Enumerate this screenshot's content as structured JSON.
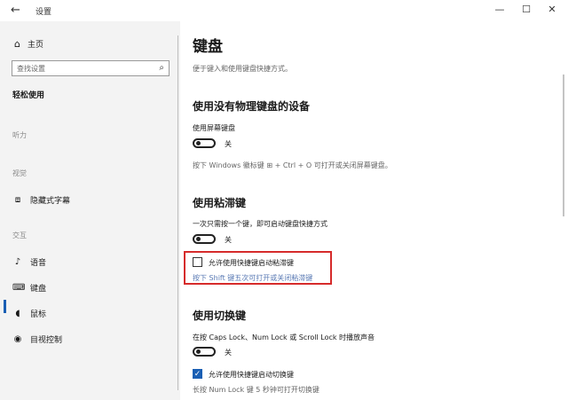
{
  "titlebar": {
    "back_glyph": "←",
    "title": "设置",
    "minimize": "—",
    "maximize": "☐",
    "close": "✕"
  },
  "sidebar": {
    "home_label": "主页",
    "search_placeholder": "查找设置",
    "category": "轻松使用",
    "groups": [
      "听力",
      "视觉",
      "交互"
    ],
    "items": [
      {
        "label": "隐藏式字幕",
        "icon": "caption-icon"
      },
      {
        "label": "语音",
        "icon": "microphone-icon"
      },
      {
        "label": "键盘",
        "icon": "keyboard-icon",
        "selected": true
      },
      {
        "label": "鼠标",
        "icon": "mouse-icon"
      },
      {
        "label": "目视控制",
        "icon": "eye-control-icon"
      }
    ]
  },
  "main": {
    "title": "键盘",
    "subtitle": "便于键入和使用键盘快捷方式。",
    "sections": {
      "osk": {
        "heading": "使用没有物理键盘的设备",
        "label": "使用屏幕键盘",
        "state": "关",
        "on": false,
        "hint": "按下 Windows 徽标键 ⊞ + Ctrl + O 可打开或关闭屏幕键盘。"
      },
      "sticky": {
        "heading": "使用粘滞键",
        "label": "一次只需按一个键，即可启动键盘快捷方式",
        "state": "关",
        "on": false,
        "checkbox_label": "允许使用快捷键启动粘滞键",
        "checked": false,
        "hint": "按下 Shift 键五次可打开或关闭粘滞键"
      },
      "toggle_keys": {
        "heading": "使用切换键",
        "label": "在按 Caps Lock、Num Lock 或 Scroll Lock 时播放声音",
        "state": "关",
        "on": false,
        "checkbox_label": "允许使用快捷键启动切换键",
        "checked": true,
        "hint": "长按 Num Lock 键 5 秒钟可打开切换键"
      }
    }
  },
  "colors": {
    "accent": "#1a5fb4",
    "highlight": "#d62b2b",
    "sidebar_bg": "#f3f3f3"
  }
}
